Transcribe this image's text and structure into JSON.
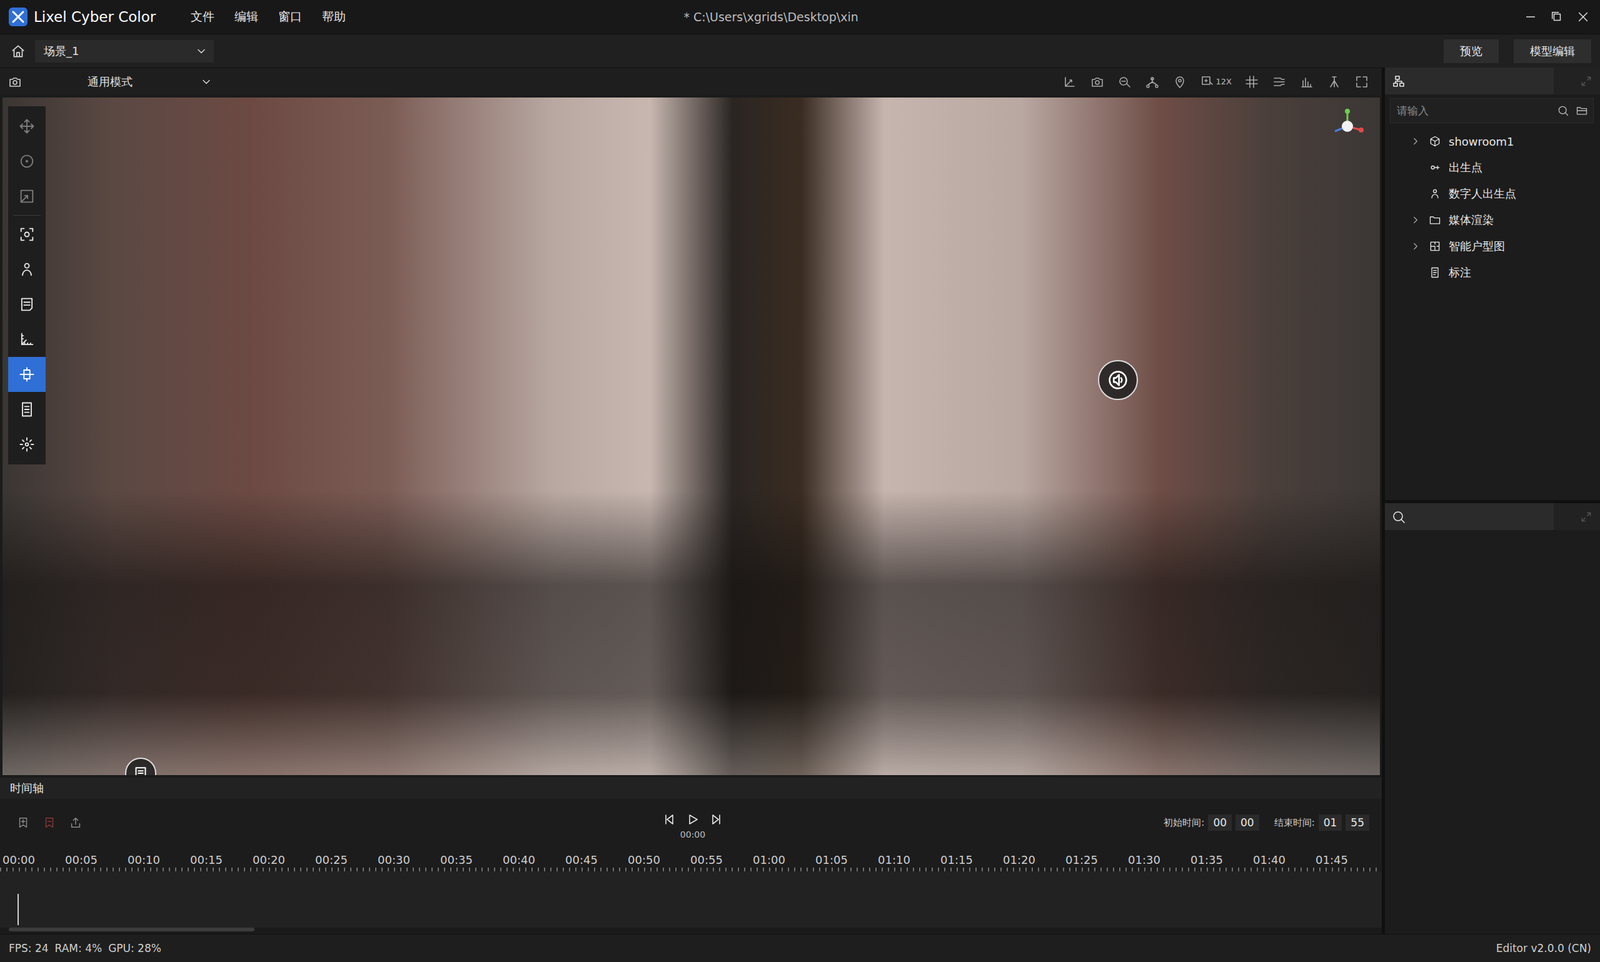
{
  "app": {
    "name": "Lixel Cyber Color",
    "title": "* C:\\Users\\xgrids\\Desktop\\xin"
  },
  "menus": [
    {
      "label": "文件"
    },
    {
      "label": "编辑"
    },
    {
      "label": "窗口"
    },
    {
      "label": "帮助"
    }
  ],
  "scene": {
    "value": "场景_1"
  },
  "header_buttons": [
    {
      "label": "预览"
    },
    {
      "label": "模型编辑"
    }
  ],
  "viewport": {
    "mode": "通用模式",
    "zoom_label": "12X"
  },
  "left_tools": [
    {
      "selected": false,
      "disabled": true
    },
    {
      "selected": false,
      "disabled": true
    },
    {
      "selected": false,
      "disabled": true
    },
    {
      "selected": false,
      "disabled": false
    },
    {
      "selected": false,
      "disabled": false
    },
    {
      "selected": false,
      "disabled": false
    },
    {
      "selected": false,
      "disabled": false
    },
    {
      "selected": true,
      "disabled": false
    },
    {
      "selected": false,
      "disabled": false
    },
    {
      "selected": false,
      "disabled": false
    }
  ],
  "tree": {
    "search_placeholder": "请输入",
    "items": [
      {
        "label": "showroom1",
        "expandable": true,
        "expanded": false
      },
      {
        "label": "出生点",
        "expandable": false,
        "expanded": false
      },
      {
        "label": "数字人出生点",
        "expandable": false,
        "expanded": false
      },
      {
        "label": "媒体渲染",
        "expandable": true,
        "expanded": false
      },
      {
        "label": "智能户型图",
        "expandable": true,
        "expanded": false
      },
      {
        "label": "标注",
        "expandable": false,
        "expanded": false
      }
    ]
  },
  "timeline": {
    "title": "时间轴",
    "current_time": "00:00",
    "start_label": "初始时间:",
    "start_time": [
      "00",
      "00"
    ],
    "end_label": "结束时间:",
    "end_time": [
      "01",
      "55"
    ],
    "ticks": [
      "00:00",
      "00:05",
      "00:10",
      "00:15",
      "00:20",
      "00:25",
      "00:30",
      "00:35",
      "00:40",
      "00:45",
      "00:50",
      "00:55",
      "01:00",
      "01:05",
      "01:10",
      "01:15",
      "01:20",
      "01:25",
      "01:30",
      "01:35",
      "01:40",
      "01:45"
    ],
    "playhead": 0,
    "scroll_thumb": 0.18
  },
  "status": {
    "metrics": [
      "FPS: 24",
      "RAM: 4%",
      "GPU: 28%"
    ],
    "version": "Editor v2.0.0 (CN)"
  }
}
